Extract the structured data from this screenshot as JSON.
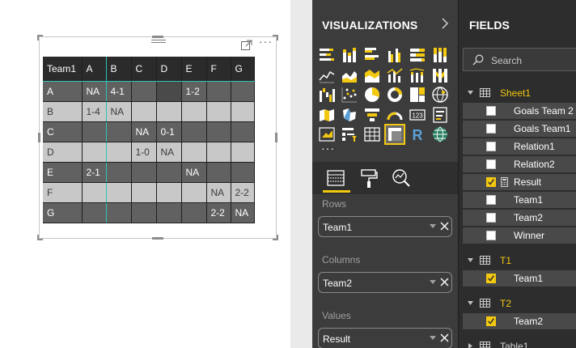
{
  "matrix": {
    "header": [
      "Team1",
      "A",
      "B",
      "C",
      "D",
      "E",
      "F",
      "G"
    ],
    "rows": [
      [
        "A",
        "NA",
        "4-1",
        "",
        "",
        "1-2",
        "",
        ""
      ],
      [
        "B",
        "1-4",
        "NA",
        "",
        "",
        "",
        "",
        ""
      ],
      [
        "C",
        "",
        "",
        "NA",
        "0-1",
        "",
        "",
        ""
      ],
      [
        "D",
        "",
        "",
        "1-0",
        "NA",
        "",
        "",
        ""
      ],
      [
        "E",
        "2-1",
        "",
        "",
        "",
        "NA",
        "",
        ""
      ],
      [
        "F",
        "",
        "",
        "",
        "",
        "",
        "NA",
        "2-2"
      ],
      [
        "G",
        "",
        "",
        "",
        "",
        "",
        "2-2",
        "NA"
      ]
    ]
  },
  "visualizations": {
    "title": "VISUALIZATIONS",
    "more_glyph": "···",
    "icons": [
      "stacked-bar-chart-icon",
      "stacked-column-chart-icon",
      "clustered-bar-chart-icon",
      "clustered-column-chart-icon",
      "100-percent-bar-chart-icon",
      "100-percent-column-chart-icon",
      "line-chart-icon",
      "area-chart-icon",
      "stacked-area-chart-icon",
      "line-column-chart-icon",
      "line-stacked-column-chart-icon",
      "ribbon-chart-icon",
      "waterfall-chart-icon",
      "scatter-chart-icon",
      "pie-chart-icon",
      "donut-chart-icon",
      "treemap-icon",
      "map-icon",
      "filled-map-icon",
      "shape-map-icon",
      "funnel-icon",
      "gauge-icon",
      "card-icon",
      "multi-row-card-icon",
      "kpi-icon",
      "slicer-icon",
      "table-icon",
      "matrix-icon",
      "r-visual-icon",
      "globe-map-icon"
    ],
    "selected_icon": "matrix-icon",
    "tabs": [
      "fields-well-tab",
      "format-tab",
      "analytics-tab"
    ],
    "wells": {
      "rows_label": "Rows",
      "rows_value": "Team1",
      "columns_label": "Columns",
      "columns_value": "Team2",
      "values_label": "Values",
      "values_value": "Result"
    }
  },
  "fields": {
    "title": "FIELDS",
    "search_placeholder": "Search",
    "tables": [
      {
        "name": "Sheet1",
        "active": true,
        "items": [
          {
            "name": "Goals Team 2",
            "checked": false,
            "calc": false
          },
          {
            "name": "Goals Team1",
            "checked": false,
            "calc": false
          },
          {
            "name": "Relation1",
            "checked": false,
            "calc": false
          },
          {
            "name": "Relation2",
            "checked": false,
            "calc": false
          },
          {
            "name": "Result",
            "checked": true,
            "calc": true
          },
          {
            "name": "Team1",
            "checked": false,
            "calc": false
          },
          {
            "name": "Team2",
            "checked": false,
            "calc": false
          },
          {
            "name": "Winner",
            "checked": false,
            "calc": false
          }
        ]
      },
      {
        "name": "T1",
        "active": true,
        "items": [
          {
            "name": "Team1",
            "checked": true,
            "calc": false
          }
        ]
      },
      {
        "name": "T2",
        "active": true,
        "items": [
          {
            "name": "Team2",
            "checked": true,
            "calc": false
          }
        ]
      },
      {
        "name": "Table1",
        "active": false,
        "items": []
      }
    ]
  },
  "colors": {
    "accent": "#f2c811",
    "teal_line": "#2ec4b6",
    "matrix_header": "#2b2b2b",
    "matrix_dark_row": "#616161",
    "matrix_light_row": "#c8c8c8"
  }
}
